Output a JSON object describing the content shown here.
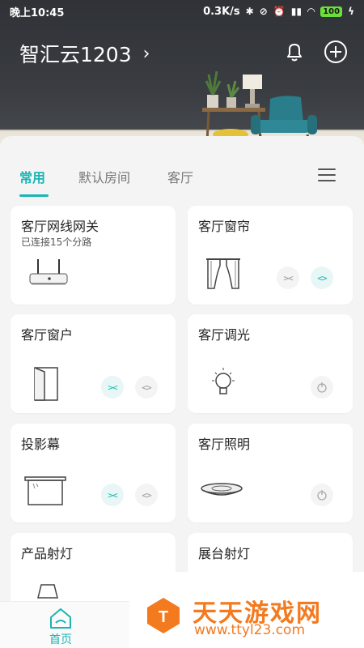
{
  "statusbar": {
    "time": "晚上10:45",
    "net_speed": "0.3K/s",
    "battery": "100"
  },
  "header": {
    "home_name": "智汇云1203",
    "chevron": "›"
  },
  "tabs": [
    {
      "label": "常用",
      "active": true
    },
    {
      "label": "默认房间",
      "active": false
    },
    {
      "label": "客厅",
      "active": false
    }
  ],
  "devices": [
    {
      "name": "客厅网线网关",
      "sub": "已连接15个分路",
      "icon": "router-icon"
    },
    {
      "name": "客厅窗帘",
      "icon": "curtain-icon",
      "controls": [
        "close",
        "open"
      ]
    },
    {
      "name": "客厅窗户",
      "icon": "window-icon",
      "controls": [
        "close",
        "open"
      ]
    },
    {
      "name": "客厅调光",
      "icon": "bulb-icon",
      "controls": [
        "power"
      ]
    },
    {
      "name": "投影幕",
      "icon": "projector-screen-icon",
      "controls": [
        "close",
        "open"
      ]
    },
    {
      "name": "客厅照明",
      "icon": "ceiling-light-icon",
      "controls": [
        "power"
      ]
    },
    {
      "name": "产品射灯",
      "icon": "spotlight-icon"
    },
    {
      "name": "展台射灯",
      "icon": "spotlight-icon"
    }
  ],
  "controls": {
    "close": "><",
    "open": "<>"
  },
  "bottomnav": {
    "home_label": "首页"
  },
  "watermark": {
    "title": "天天游戏网",
    "url": "www.ttyl23.com"
  },
  "colors": {
    "accent": "#19b5b5",
    "watermark": "#f37a1f"
  }
}
